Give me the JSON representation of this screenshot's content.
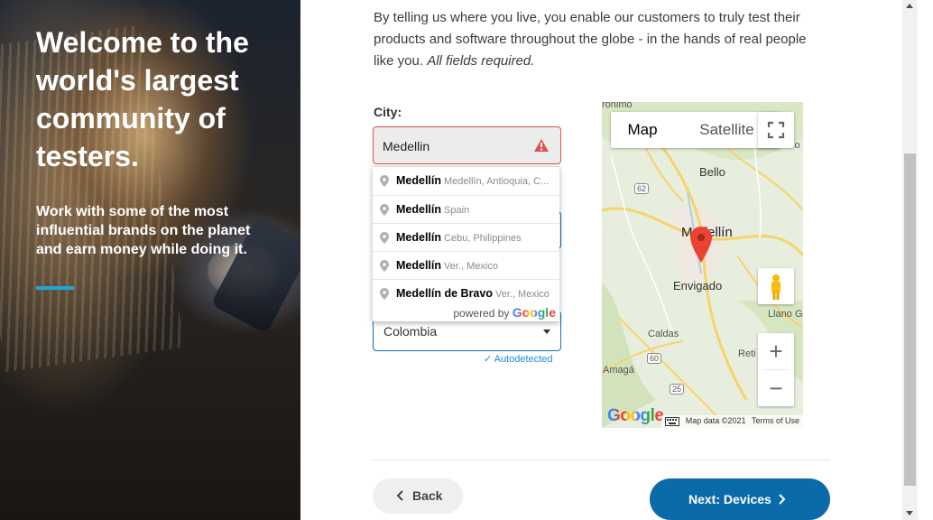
{
  "hero": {
    "title": "Welcome to the world's largest community of testers.",
    "subtitle": "Work with some of the most influential brands on the planet and earn money while doing it.",
    "accent_color": "#1fa5d6"
  },
  "intro": {
    "text": "By telling us where you live, you enable our customers to truly test their products and software throughout the globe - in the hands of real people like you.",
    "required_note": "All fields required."
  },
  "city": {
    "label": "City:",
    "value": "Medellin",
    "error_icon": "warning-icon"
  },
  "autocomplete": {
    "items": [
      {
        "main": "Medellín",
        "secondary": "Medellín, Antioquia, C..."
      },
      {
        "main": "Medellín",
        "secondary": "Spain"
      },
      {
        "main": "Medellín",
        "secondary": "Cebu, Philippines"
      },
      {
        "main": "Medellín",
        "secondary": "Ver., Mexico"
      },
      {
        "main": "Medellín de Bravo",
        "secondary": "Ver., Mexico"
      }
    ],
    "powered_by": "powered by",
    "google": "Google"
  },
  "country": {
    "value": "Colombia",
    "autodetected": "✓ Autodetected"
  },
  "map": {
    "type_map": "Map",
    "type_satellite": "Satellite",
    "labels": {
      "bello": "Bello",
      "medellin": "Medellín",
      "envigado": "Envigado",
      "caldas": "Caldas",
      "amaga": "Amagá",
      "llano": "Llano G",
      "retiro": "Reti",
      "girardota": "Girardo",
      "top_left": "ronimo",
      "r62": "62",
      "r60": "60",
      "r25": "25"
    },
    "google": "Google",
    "map_data": "Map data ©2021",
    "terms": "Terms of Use",
    "zoom_in": "+",
    "zoom_out": "−"
  },
  "nav": {
    "back": "Back",
    "next": "Next: Devices",
    "next_color": "#0b6ba9"
  }
}
